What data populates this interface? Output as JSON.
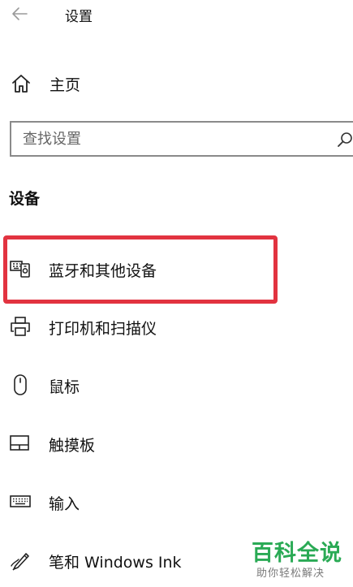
{
  "window": {
    "title": "设置"
  },
  "nav": {
    "home_label": "主页"
  },
  "search": {
    "placeholder": "查找设置",
    "value": ""
  },
  "section": {
    "heading": "设备"
  },
  "devices": {
    "items": [
      {
        "label": "蓝牙和其他设备",
        "icon": "bluetooth-devices-icon"
      },
      {
        "label": "打印机和扫描仪",
        "icon": "printer-icon"
      },
      {
        "label": "鼠标",
        "icon": "mouse-icon"
      },
      {
        "label": "触摸板",
        "icon": "touchpad-icon"
      },
      {
        "label": "输入",
        "icon": "keyboard-icon"
      },
      {
        "label": "笔和 Windows Ink",
        "icon": "pen-icon"
      }
    ]
  },
  "watermark": {
    "title": "百科全说",
    "subtitle": "助你轻松解决"
  },
  "colors": {
    "highlight": "#e23340",
    "watermark_green": "#2aaa55"
  }
}
